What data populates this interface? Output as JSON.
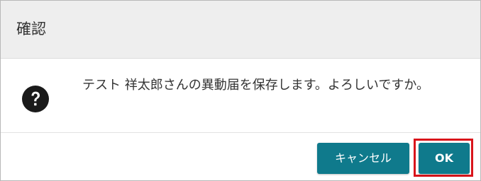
{
  "dialog": {
    "title": "確認",
    "message": "テスト 祥太郎さんの異動届を保存します。よろしいですか。",
    "icon": "question-circle-icon",
    "buttons": {
      "cancel_label": "キャンセル",
      "ok_label": "OK"
    }
  },
  "colors": {
    "header_bg": "#eeeeee",
    "button_bg": "#0f7a8c",
    "highlight": "#d9141b",
    "text": "#333333"
  }
}
